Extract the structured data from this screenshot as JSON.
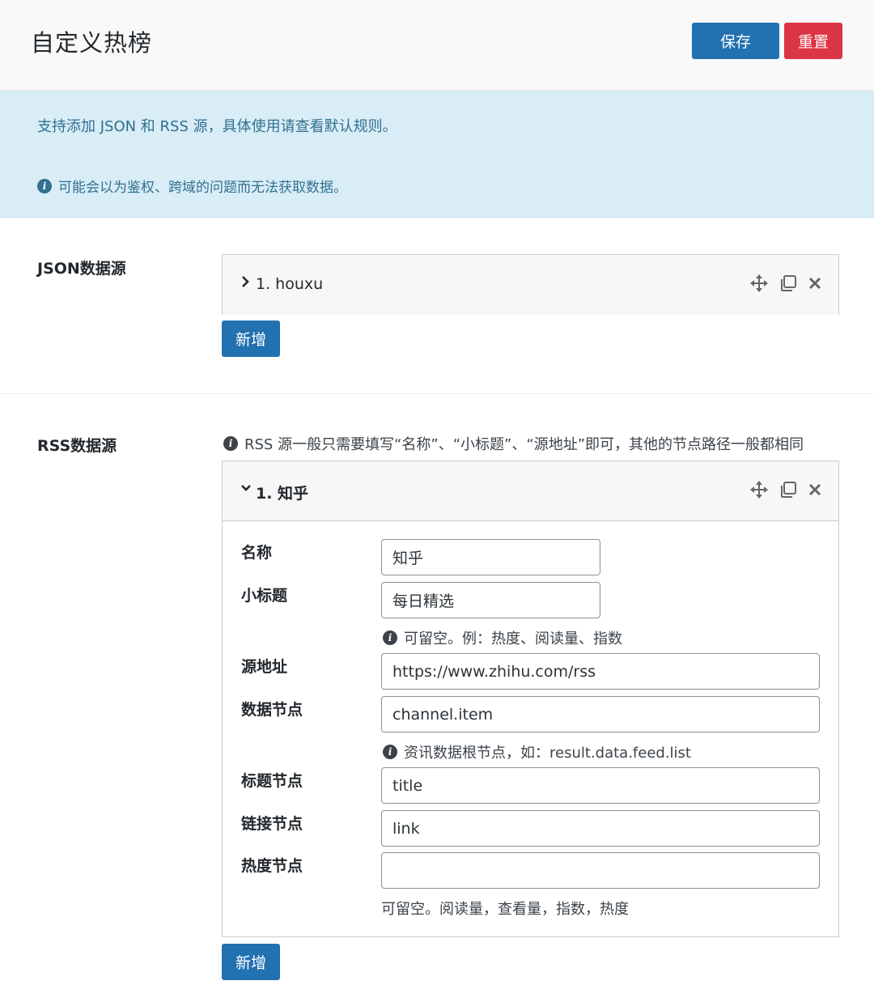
{
  "header": {
    "title": "自定义热榜",
    "save_label": "保存",
    "reset_label": "重置"
  },
  "notice": {
    "line1": "支持添加 JSON 和 RSS 源，具体使用请查看默认规则。",
    "line2": "可能会以为鉴权、跨域的问题而无法获取数据。"
  },
  "json_section": {
    "label": "JSON数据源",
    "items": [
      {
        "title": "1. houxu",
        "expanded": false
      }
    ],
    "add_label": "新增"
  },
  "rss_section": {
    "label": "RSS数据源",
    "hint": "RSS 源一般只需要填写“名称”、“小标题”、“源地址”即可，其他的节点路径一般都相同",
    "items": [
      {
        "title": "1. 知乎",
        "expanded": true,
        "fields": {
          "name": {
            "label": "名称",
            "value": "知乎"
          },
          "subtitle": {
            "label": "小标题",
            "value": "每日精选",
            "hint": "可留空。例：热度、阅读量、指数"
          },
          "url": {
            "label": "源地址",
            "value": "https://www.zhihu.com/rss"
          },
          "data_node": {
            "label": "数据节点",
            "value": "channel.item",
            "hint": "资讯数据根节点，如：result.data.feed.list"
          },
          "title_node": {
            "label": "标题节点",
            "value": "title"
          },
          "link_node": {
            "label": "链接节点",
            "value": "link"
          },
          "hot_node": {
            "label": "热度节点",
            "value": "",
            "hint": "可留空。阅读量，查看量，指数，热度"
          }
        }
      }
    ],
    "add_label": "新增"
  },
  "icons": {
    "info": "info-icon",
    "move": "move-icon",
    "copy": "copy-icon",
    "close": "close-icon",
    "chevron_right": "chevron-right-icon",
    "chevron_down": "chevron-down-icon"
  },
  "colors": {
    "primary": "#2271b1",
    "danger": "#dc3545",
    "notice_bg": "#d9edf7",
    "notice_text": "#31708f"
  }
}
